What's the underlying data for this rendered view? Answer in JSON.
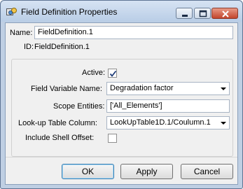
{
  "window": {
    "title": "Field Definition Properties",
    "icon": "properties-window-icon"
  },
  "title_controls": {
    "minimize": "minimize-icon",
    "maximize": "maximize-icon",
    "close": "close-icon"
  },
  "name": {
    "label": "Name:",
    "value": "FieldDefinition.1"
  },
  "id": {
    "label": "ID:",
    "value": "FieldDefinition.1"
  },
  "active": {
    "label": "Active:",
    "checked": true
  },
  "field_variable_name": {
    "label": "Field Variable Name:",
    "value": "Degradation factor"
  },
  "scope_entities": {
    "label": "Scope Entities:",
    "value": "['All_Elements']"
  },
  "lookup_table_column": {
    "label": "Look-up Table Column:",
    "value": "LookUpTable1D.1/Coulumn.1"
  },
  "include_shell_offset": {
    "label": "Include Shell Offset:",
    "checked": false
  },
  "buttons": {
    "ok": "OK",
    "apply": "Apply",
    "cancel": "Cancel"
  },
  "colors": {
    "titlebar": "#c6d7ec",
    "dialog_bg": "#f0f0f0",
    "default_button_border": "#3c7fb1"
  }
}
